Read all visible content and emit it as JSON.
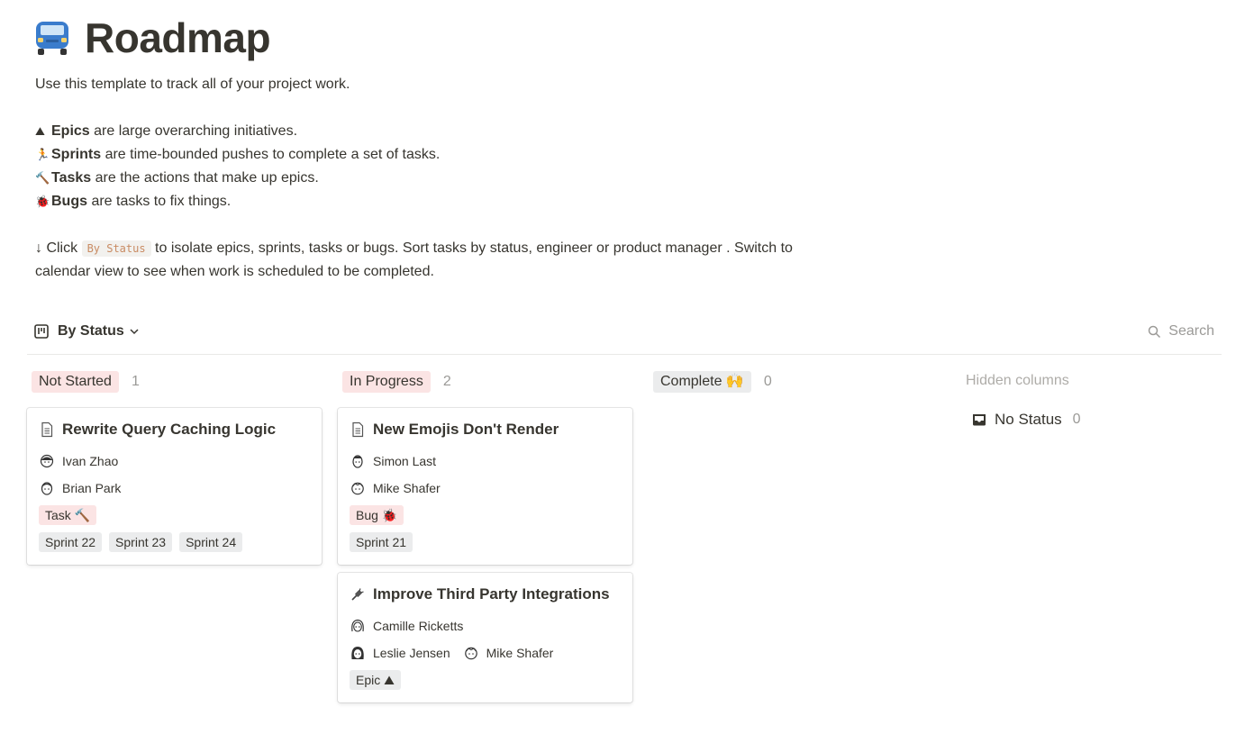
{
  "page": {
    "icon": "car-icon",
    "title": "Roadmap",
    "intro": "Use this template to track all of your project work.",
    "legend": [
      {
        "icon": "mountain-icon",
        "emoji": "⛰",
        "bold": "Epics",
        "rest": " are large overarching initiatives."
      },
      {
        "icon": "runner-icon",
        "emoji": "🏃",
        "bold": "Sprints",
        "rest": " are time-bounded pushes to complete a set of tasks."
      },
      {
        "icon": "hammer-icon",
        "emoji": "🔨",
        "bold": "Tasks",
        "rest": " are the actions that make up epics."
      },
      {
        "icon": "bug-icon",
        "emoji": "🐞",
        "bold": "Bugs",
        "rest": " are tasks to fix things."
      }
    ],
    "instruction_prefix": "↓ Click ",
    "instruction_code": "By Status",
    "instruction_suffix": " to isolate epics, sprints, tasks or bugs. Sort tasks by status, engineer or product manager . Switch to",
    "instruction_line2": "calendar view to see when work is scheduled to be completed."
  },
  "toolbar": {
    "view_label": "By Status",
    "search_label": "Search"
  },
  "columns": [
    {
      "label": "Not Started",
      "count": "1",
      "color": "#fbe4e4",
      "cards": [
        {
          "icon": "page-icon",
          "title": "Rewrite Query Caching Logic",
          "people": [
            [
              "Ivan Zhao"
            ],
            [
              "Brian Park"
            ]
          ],
          "type_tag": "Task 🔨",
          "type_color": "#fbe4e4",
          "sprints": [
            "Sprint 22",
            "Sprint 23",
            "Sprint 24"
          ]
        }
      ]
    },
    {
      "label": "In Progress",
      "count": "2",
      "color": "#fbe4e4",
      "cards": [
        {
          "icon": "page-icon",
          "title": "New Emojis Don't Render",
          "people": [
            [
              "Simon Last"
            ],
            [
              "Mike Shafer"
            ]
          ],
          "type_tag": "Bug 🐞",
          "type_color": "#fbe4e4",
          "sprints": [
            "Sprint 21"
          ]
        },
        {
          "icon": "plug-icon",
          "title": "Improve Third Party Integrations",
          "people": [
            [
              "Camille Ricketts"
            ],
            [
              "Leslie Jensen",
              "Mike Shafer"
            ]
          ],
          "type_tag": "Epic ⛰",
          "type_color": "#ebeced",
          "sprints": []
        }
      ]
    },
    {
      "label": "Complete 🙌",
      "count": "0",
      "color": "#ebeced",
      "cards": []
    }
  ],
  "hidden": {
    "label": "Hidden columns",
    "no_status_label": "No Status",
    "no_status_count": "0"
  },
  "colors": {
    "text": "#37352f",
    "muted": "#9b9a97",
    "tag_gray": "#ebeced",
    "tag_red": "#fbe4e4"
  }
}
